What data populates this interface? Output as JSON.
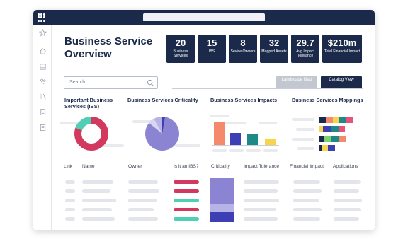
{
  "page": {
    "title": "Business Service Overview"
  },
  "stats": [
    {
      "value": "20",
      "label": "Business Services"
    },
    {
      "value": "15",
      "label": "IBS"
    },
    {
      "value": "8",
      "label": "Sevice Owners"
    },
    {
      "value": "32",
      "label": "Mapped Assets"
    },
    {
      "value": "29.7",
      "label": "Avg Impact Tolerance"
    },
    {
      "value": "$210m",
      "label": "Total Financial Impact"
    }
  ],
  "search": {
    "placeholder": "Search"
  },
  "buttons": {
    "landscape": "Landscape Map",
    "catalog": "Catalog View"
  },
  "sections": {
    "ibs": "Important Business Services (IBS)",
    "criticality": "Business Services Criticality",
    "impacts": "Business Services Impacts",
    "mappings": "Business Services Mappings"
  },
  "table": {
    "columns": [
      "Link",
      "Name",
      "Owner",
      "Is it an IBS?",
      "Criticality",
      "Impact Tolerance",
      "Financial Impact",
      "Applications"
    ]
  },
  "colors": {
    "navy": "#1b2a4a",
    "crimson": "#d13a5e",
    "teal": "#4fd0b5",
    "purple": "#8b84d2",
    "orange": "#f4896b",
    "indigo": "#3d40b5",
    "dark_teal": "#1d8a88",
    "yellow": "#f6d44e",
    "pink": "#e8537c",
    "green": "#7bd06f"
  },
  "sidebar_icons": [
    "star-icon",
    "home-icon",
    "grid-icon",
    "users-icon",
    "library-icon",
    "document-icon",
    "report-icon"
  ]
}
